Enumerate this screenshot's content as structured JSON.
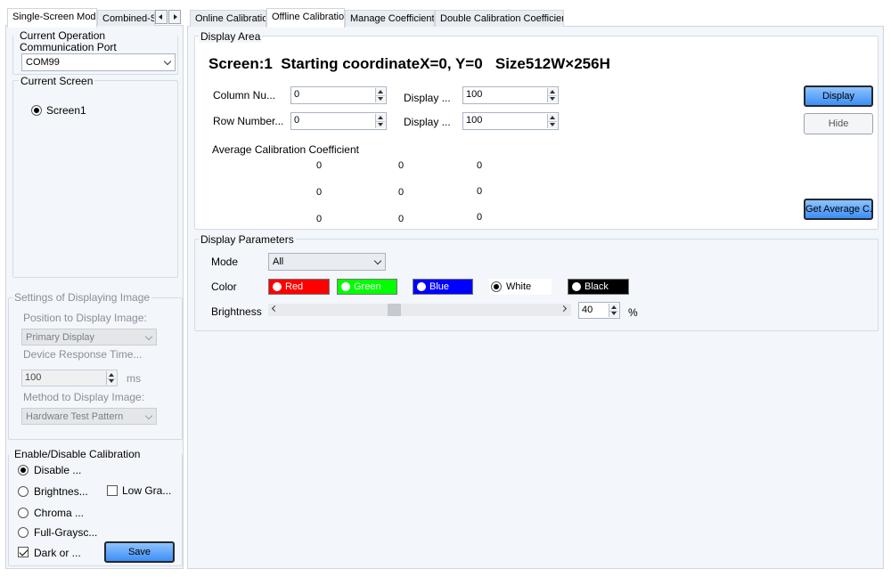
{
  "left_tabs": {
    "tab1": "Single-Screen Mode",
    "tab2": "Combined-Sc"
  },
  "operation": {
    "title": "Current Operation Communication Port",
    "port": "COM99"
  },
  "current_screen": {
    "title": "Current Screen",
    "screen": "Screen1"
  },
  "image_settings": {
    "title": "Settings of Displaying Image",
    "position_label": "Position to Display Image:",
    "position_value": "Primary Display",
    "response_label": "Device Response Time...",
    "response_value": "100",
    "response_unit": "ms",
    "method_label": "Method to Display Image:",
    "method_value": "Hardware Test Pattern"
  },
  "calibration": {
    "title": "Enable/Disable Calibration",
    "disable": "Disable ...",
    "brightness": "Brightnes...",
    "low_gray": "Low Gra...",
    "chroma": "Chroma ...",
    "full_gray": "Full-Graysc...",
    "dark": "Dark or ...",
    "save": "Save"
  },
  "main_tabs": {
    "online": "Online Calibration",
    "offline": "Offline Calibration",
    "manage": "Manage Coefficients",
    "double": "Double Calibration Coefficients"
  },
  "display_area": {
    "title": "Display Area",
    "heading": "Screen:1  Starting coordinateX=0, Y=0   Size512W×256H",
    "column_label": "Column Nu...",
    "column_value": "0",
    "row_label": "Row Number...",
    "row_value": "0",
    "display1_label": "Display ...",
    "display1_value": "100",
    "display2_label": "Display ...",
    "display2_value": "100",
    "avg_title": "Average Calibration Coefficient",
    "coefficients": [
      [
        "0",
        "0",
        "0"
      ],
      [
        "0",
        "0",
        "0"
      ],
      [
        "0",
        "0",
        "0"
      ]
    ],
    "display_btn": "Display",
    "hide_btn": "Hide",
    "get_avg_btn": "Get Average C..."
  },
  "display_params": {
    "title": "Display Parameters",
    "mode_label": "Mode",
    "mode_value": "All",
    "color_label": "Color",
    "colors": {
      "red": "Red",
      "green": "Green",
      "blue": "Blue",
      "white": "White",
      "black": "Black"
    },
    "brightness_label": "Brightness",
    "brightness_value": "40",
    "brightness_unit": "%"
  },
  "theme": {
    "red": "#ff0000",
    "green": "#00ff00",
    "blue": "#0000ff",
    "black": "#000000",
    "accent_blue": "#3d8ef5"
  }
}
